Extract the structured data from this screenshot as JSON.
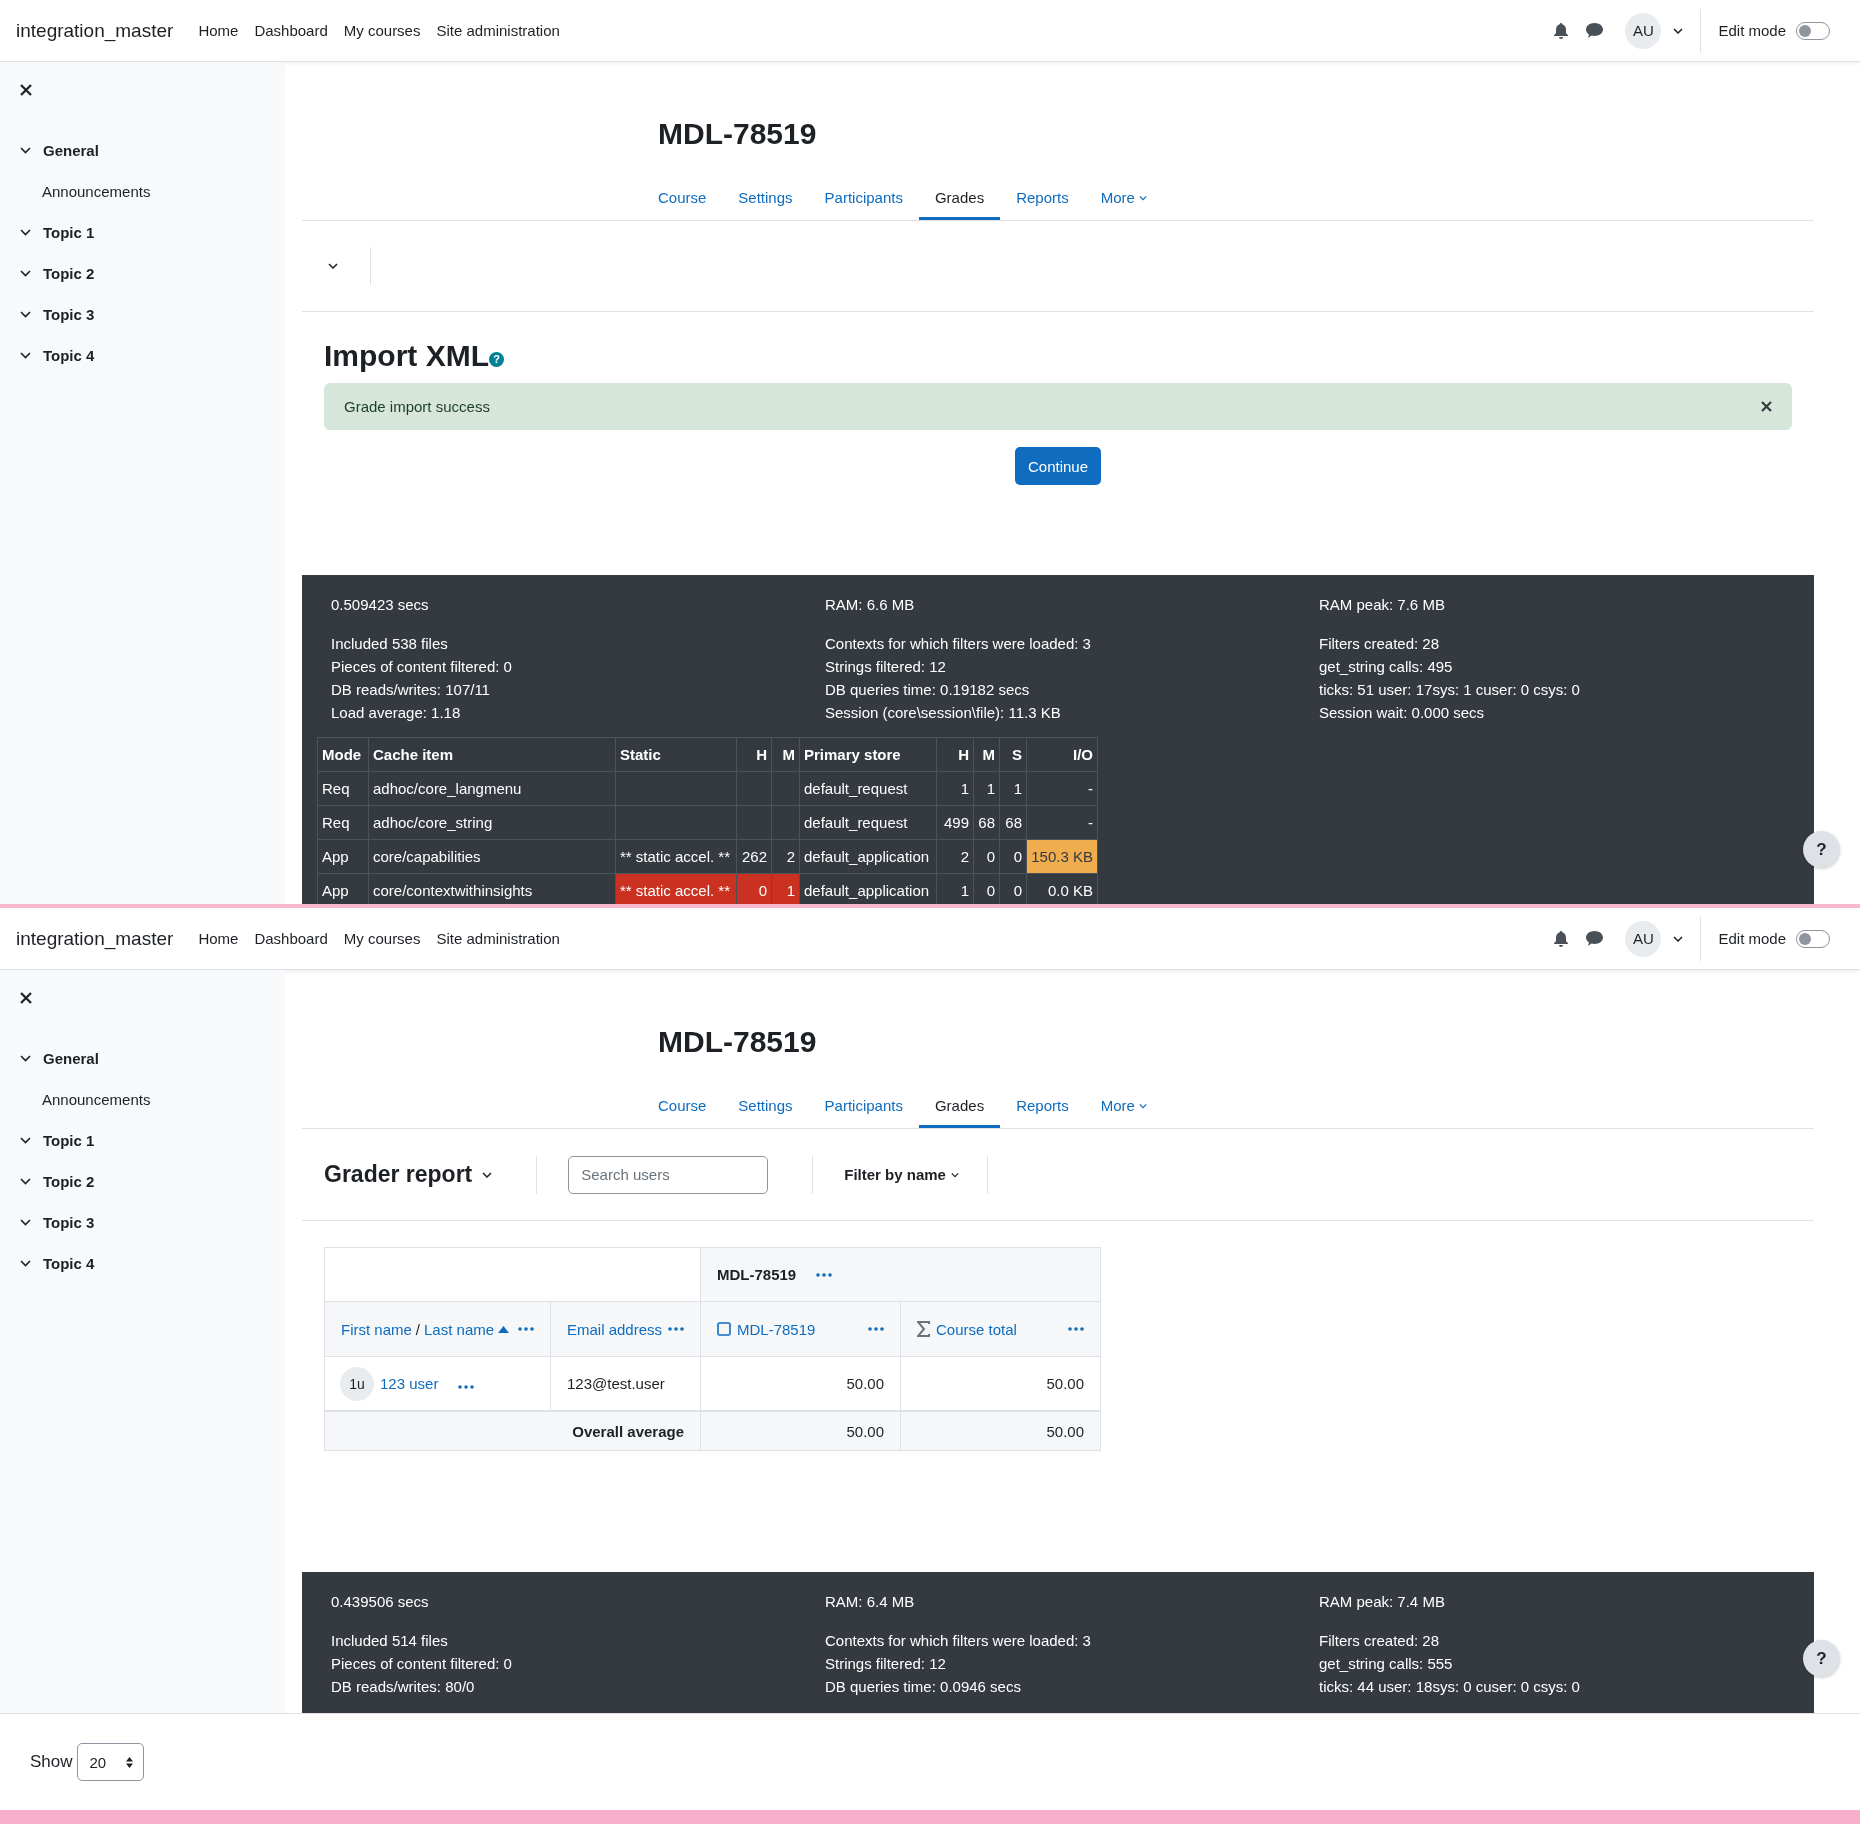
{
  "screens": [
    {
      "header": {
        "site_name": "integration_master",
        "nav": [
          "Home",
          "Dashboard",
          "My courses",
          "Site administration"
        ],
        "avatar": "AU",
        "edit_mode": {
          "label": "Edit mode",
          "on": false
        }
      },
      "sidebar": {
        "items": [
          {
            "label": "General",
            "expanded": true,
            "children": [
              "Announcements"
            ]
          },
          {
            "label": "Topic 1",
            "expanded": true
          },
          {
            "label": "Topic 2",
            "expanded": true
          },
          {
            "label": "Topic 3",
            "expanded": true
          },
          {
            "label": "Topic 4",
            "expanded": true
          }
        ]
      },
      "course_title": "MDL-78519",
      "tabs": [
        {
          "label": "Course",
          "selected": false
        },
        {
          "label": "Settings",
          "selected": false
        },
        {
          "label": "Participants",
          "selected": false
        },
        {
          "label": "Grades",
          "selected": true
        },
        {
          "label": "Reports",
          "selected": false
        },
        {
          "label": "More",
          "selected": false
        }
      ],
      "page": {
        "kind": "import",
        "heading": "Import XML",
        "help": "?",
        "alert": "Grade import success",
        "button": "Continue"
      },
      "debug": {
        "summary": [
          "0.509423 secs",
          "RAM: 6.6 MB",
          "RAM peak: 7.6 MB"
        ],
        "columns": [
          [
            "Included 538 files",
            "Pieces of content filtered: 0",
            "DB reads/writes: 107/11",
            "Load average: 1.18"
          ],
          [
            "Contexts for which filters were loaded: 3",
            "Strings filtered: 12",
            "DB queries time: 0.19182 secs",
            "Session (core\\session\\file): 11.3 KB"
          ],
          [
            "Filters created: 28",
            "get_string calls: 495",
            "ticks: 51 user: 17sys: 1 cuser: 0 csys: 0",
            "Session wait: 0.000 secs"
          ]
        ],
        "cache_table": {
          "columns": [
            "Mode",
            "Cache item",
            "Static",
            "H",
            "M",
            "Primary store",
            "H",
            "M",
            "S",
            "I/O"
          ],
          "rows": [
            {
              "mode": "Req",
              "cache_item": "adhoc/core_langmenu",
              "primary_store": "default_request",
              "h": "1",
              "m": "1",
              "s": "1",
              "io": "-"
            },
            {
              "mode": "Req",
              "cache_item": "adhoc/core_string",
              "primary_store": "default_request",
              "h": "499",
              "m": "68",
              "s": "68",
              "io": "-"
            },
            {
              "mode": "App",
              "cache_item": "core/capabilities",
              "static": "** static accel. **",
              "static_h": "262",
              "static_m": "2",
              "primary_store": "default_application",
              "h": "2",
              "m": "0",
              "s": "0",
              "io": "150.3 KB",
              "io_highlight": {
                "color": "#f0ad4e"
              }
            },
            {
              "mode": "App",
              "cache_item": "core/contextwithinsights",
              "static": "** static accel. **",
              "static_h": "0",
              "static_m": "1",
              "static_highlight": {
                "color": "#ca3120"
              },
              "primary_store": "default_application",
              "h": "1",
              "m": "0",
              "s": "0",
              "io": "0.0 KB"
            }
          ]
        }
      },
      "help_button": "?"
    },
    {
      "header": {
        "site_name": "integration_master",
        "nav": [
          "Home",
          "Dashboard",
          "My courses",
          "Site administration"
        ],
        "avatar": "AU",
        "edit_mode": {
          "label": "Edit mode",
          "on": false
        }
      },
      "sidebar": {
        "items": [
          {
            "label": "General",
            "expanded": true,
            "children": [
              "Announcements"
            ]
          },
          {
            "label": "Topic 1",
            "expanded": true
          },
          {
            "label": "Topic 2",
            "expanded": true
          },
          {
            "label": "Topic 3",
            "expanded": true
          },
          {
            "label": "Topic 4",
            "expanded": true
          }
        ]
      },
      "course_title": "MDL-78519",
      "tabs": [
        {
          "label": "Course",
          "selected": false
        },
        {
          "label": "Settings",
          "selected": false
        },
        {
          "label": "Participants",
          "selected": false
        },
        {
          "label": "Grades",
          "selected": true
        },
        {
          "label": "Reports",
          "selected": false
        },
        {
          "label": "More",
          "selected": false
        }
      ],
      "page": {
        "kind": "grader",
        "report_selector": "Grader report",
        "search_placeholder": "Search users",
        "filter": "Filter by name",
        "table": {
          "group_header": "MDL-78519",
          "columns": [
            {
              "kind": "name",
              "first": "First name",
              "separator": "/",
              "last": "Last name",
              "sorted": true
            },
            {
              "kind": "field",
              "label": "Email address"
            },
            {
              "kind": "item",
              "label": "MDL-78519"
            },
            {
              "kind": "total",
              "label": "Course total"
            }
          ],
          "rows": [
            {
              "initials": "1u",
              "name": "123 user",
              "email": "123@test.user",
              "grades": [
                "50.00",
                "50.00"
              ]
            }
          ],
          "average": {
            "label": "Overall average",
            "values": [
              "50.00",
              "50.00"
            ]
          }
        }
      },
      "debug": {
        "summary": [
          "0.439506 secs",
          "RAM: 6.4 MB",
          "RAM peak: 7.4 MB"
        ],
        "columns": [
          [
            "Included 514 files",
            "Pieces of content filtered: 0",
            "DB reads/writes: 80/0"
          ],
          [
            "Contexts for which filters were loaded: 3",
            "Strings filtered: 12",
            "DB queries time: 0.0946 secs"
          ],
          [
            "Filters created: 28",
            "get_string calls: 555",
            "ticks: 44 user: 18sys: 0 cuser: 0 csys: 0"
          ]
        ]
      },
      "help_button": "?"
    }
  ],
  "bottom_bar": {
    "label": "Show",
    "per_page": "20"
  }
}
